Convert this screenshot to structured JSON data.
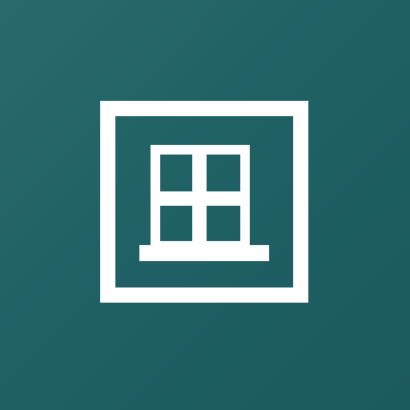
{
  "app_icon": {
    "icon_name": "window-icon",
    "background_color": "#1f6164",
    "foreground_color": "#ffffff"
  }
}
